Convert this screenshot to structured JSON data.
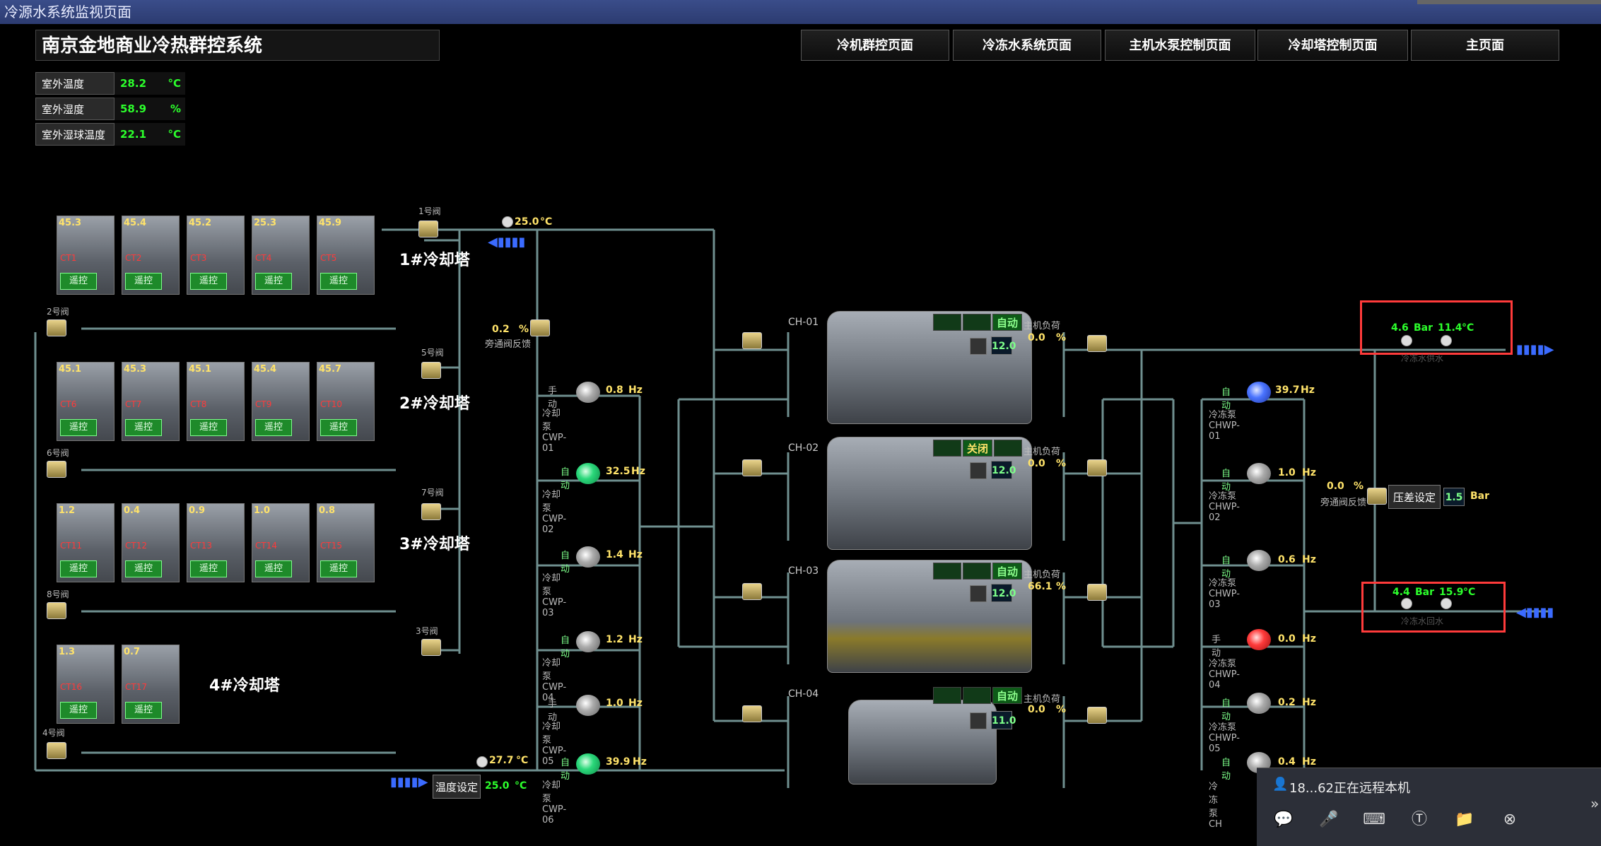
{
  "window": {
    "title": "冷源水系统监视页面"
  },
  "header": {
    "system_title": "南京金地商业冷热群控系统"
  },
  "nav": [
    {
      "label": "冷机群控页面"
    },
    {
      "label": "冷冻水系统页面"
    },
    {
      "label": "主机水泵控制页面"
    },
    {
      "label": "冷却塔控制页面"
    },
    {
      "label": "主页面"
    }
  ],
  "weather": [
    {
      "label": "室外温度",
      "value": "28.2",
      "unit": "°C"
    },
    {
      "label": "室外湿度",
      "value": "58.9",
      "unit": "%"
    },
    {
      "label": "室外湿球温度",
      "value": "22.1",
      "unit": "°C"
    }
  ],
  "towers": [
    {
      "name": "1#冷却塔",
      "valve": "1号阀",
      "bottom_valve": "2号阀",
      "cells": [
        {
          "hz": "45.3",
          "ct": "CT1"
        },
        {
          "hz": "45.4",
          "ct": "CT2"
        },
        {
          "hz": "45.2",
          "ct": "CT3"
        },
        {
          "hz": "25.3",
          "ct": "CT4"
        },
        {
          "hz": "45.9",
          "ct": "CT5"
        }
      ]
    },
    {
      "name": "2#冷却塔",
      "valve": "5号阀",
      "bottom_valve": "6号阀",
      "cells": [
        {
          "hz": "45.1",
          "ct": "CT6"
        },
        {
          "hz": "45.3",
          "ct": "CT7"
        },
        {
          "hz": "45.1",
          "ct": "CT8"
        },
        {
          "hz": "45.4",
          "ct": "CT9"
        },
        {
          "hz": "45.7",
          "ct": "CT10"
        }
      ]
    },
    {
      "name": "3#冷却塔",
      "valve": "7号阀",
      "bottom_valve": "8号阀",
      "cells": [
        {
          "hz": "1.2",
          "ct": "CT11"
        },
        {
          "hz": "0.4",
          "ct": "CT12"
        },
        {
          "hz": "0.9",
          "ct": "CT13"
        },
        {
          "hz": "1.0",
          "ct": "CT14"
        },
        {
          "hz": "0.8",
          "ct": "CT15"
        }
      ]
    },
    {
      "name": "4#冷却塔",
      "valve": "3号阀",
      "bottom_valve": "4号阀",
      "cells": [
        {
          "hz": "1.3",
          "ct": "CT16"
        },
        {
          "hz": "0.7",
          "ct": "CT17"
        }
      ]
    }
  ],
  "common": {
    "hz_unit": "Hz",
    "mode_remote": "遥控",
    "pct": "%",
    "deg": "°C",
    "bar": "Bar"
  },
  "cooling_supply_temp": "25.0",
  "cooling_return_temp": "27.7",
  "bypass_left": {
    "value": "0.2",
    "label": "旁通阀反馈"
  },
  "temp_setting": {
    "label": "温度设定",
    "value": "25.0"
  },
  "cw_pumps": [
    {
      "mode": "手动",
      "hz": "0.8",
      "name": "冷却泵 CWP-01",
      "color": "grey"
    },
    {
      "mode": "自动",
      "hz": "32.5",
      "name": "冷却泵 CWP-02",
      "color": "green"
    },
    {
      "mode": "自动",
      "hz": "1.4",
      "name": "冷却泵 CWP-03",
      "color": "grey"
    },
    {
      "mode": "自动",
      "hz": "1.2",
      "name": "冷却泵 CWP-04",
      "color": "grey"
    },
    {
      "mode": "手动",
      "hz": "1.0",
      "name": "冷却泵 CWP-05",
      "color": "grey"
    },
    {
      "mode": "自动",
      "hz": "39.9",
      "name": "冷却泵 CWP-06",
      "color": "green"
    }
  ],
  "chillers": [
    {
      "name": "CH-01",
      "state": "自动",
      "state_kind": "on",
      "set": "12.0",
      "load_label": "主机负荷",
      "load": "0.0"
    },
    {
      "name": "CH-02",
      "state": "关闭",
      "state_kind": "off",
      "set": "12.0",
      "load_label": "主机负荷",
      "load": "0.0"
    },
    {
      "name": "CH-03",
      "state": "自动",
      "state_kind": "on",
      "set": "12.0",
      "load_label": "主机负荷",
      "load": "66.1"
    },
    {
      "name": "CH-04",
      "state": "自动",
      "state_kind": "on",
      "set": "11.0",
      "load_label": "主机负荷",
      "load": "0.0"
    }
  ],
  "chw_pumps": [
    {
      "mode": "自动",
      "hz": "39.7",
      "name": "冷冻泵 CHWP-01",
      "color": "blue"
    },
    {
      "mode": "自动",
      "hz": "1.0",
      "name": "冷冻泵 CHWP-02",
      "color": "grey"
    },
    {
      "mode": "自动",
      "hz": "0.6",
      "name": "冷冻泵 CHWP-03",
      "color": "grey"
    },
    {
      "mode": "手动",
      "hz": "0.0",
      "name": "冷冻泵 CHWP-04",
      "color": "red"
    },
    {
      "mode": "自动",
      "hz": "0.2",
      "name": "冷冻泵 CHWP-05",
      "color": "grey"
    },
    {
      "mode": "自动",
      "hz": "0.4",
      "name": "冷冻泵 CH",
      "color": "grey"
    }
  ],
  "supply": {
    "pressure": "4.6",
    "temp": "11.4",
    "label": "冷冻水供水"
  },
  "return": {
    "pressure": "4.4",
    "temp": "15.9",
    "label": "冷冻水回水"
  },
  "bypass_right": {
    "value": "0.0",
    "label": "旁通阀反馈"
  },
  "dp_setting": {
    "label": "压差设定",
    "value": "1.5"
  },
  "remote": {
    "status": "18...62正在远程本机"
  }
}
